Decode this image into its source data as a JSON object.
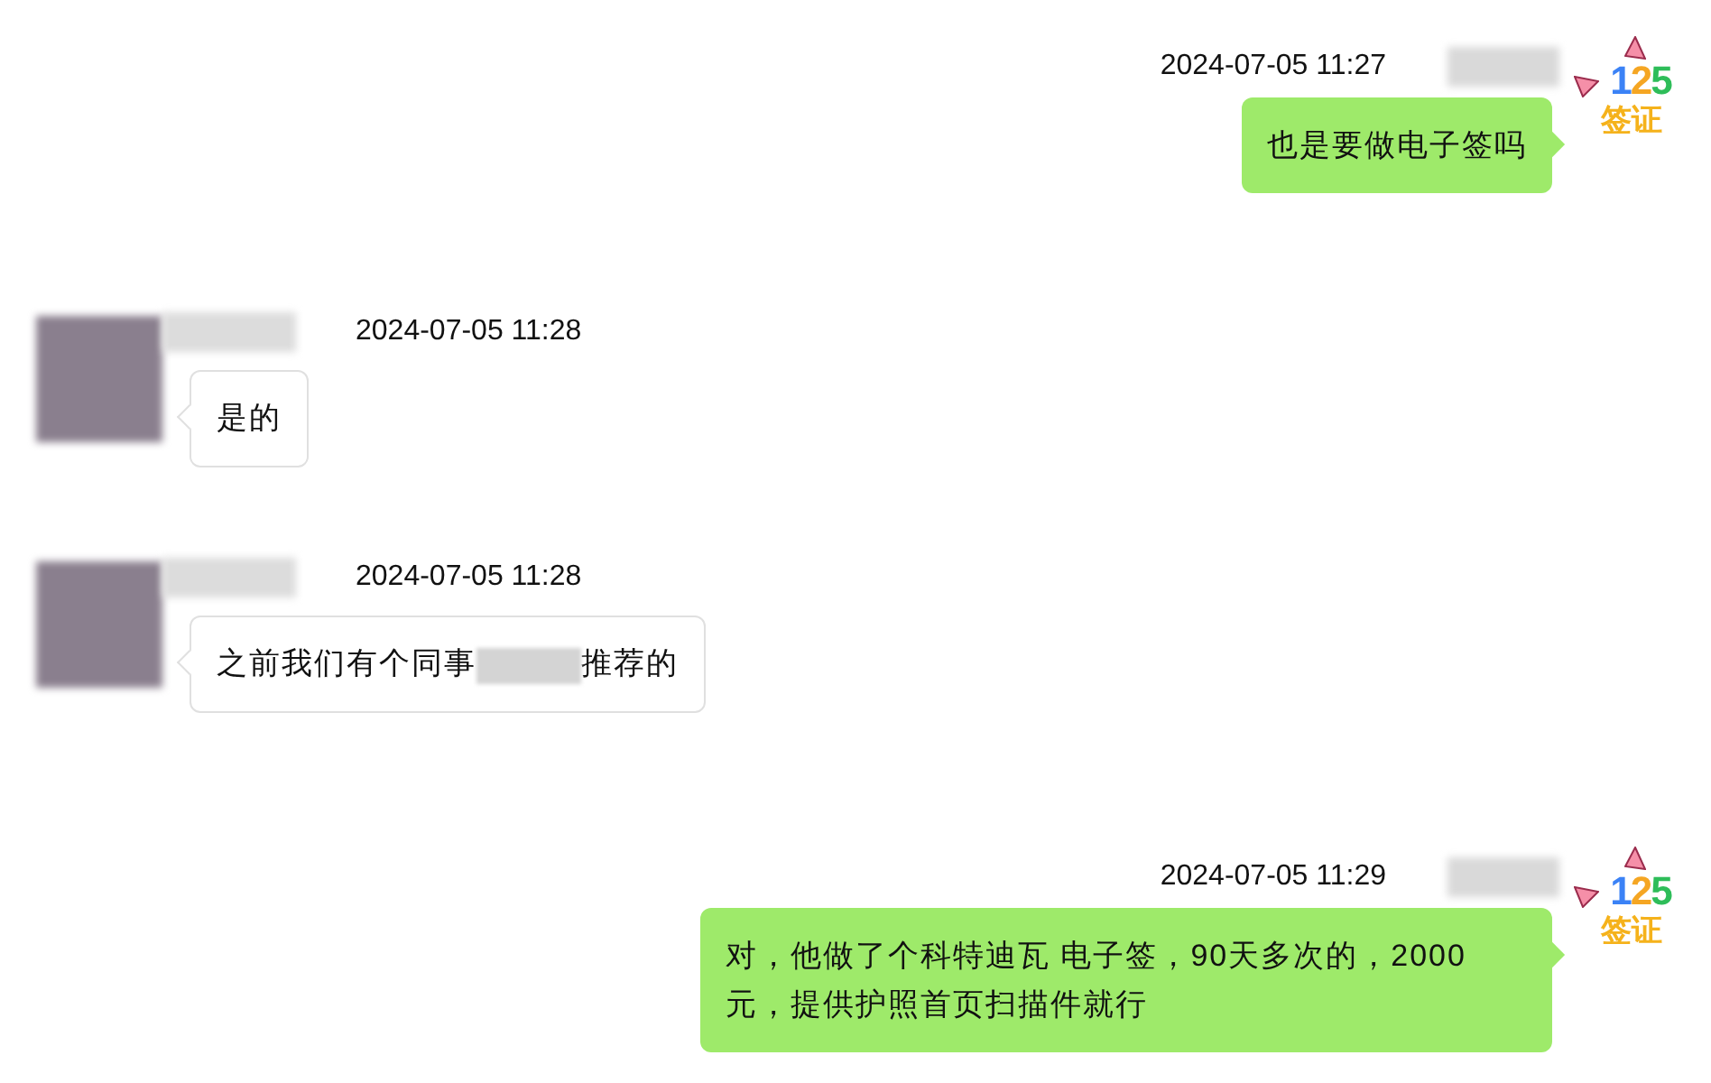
{
  "messages": [
    {
      "kind": "sent",
      "time": "2024-07-05 11:27",
      "segments": [
        {
          "kind": "text",
          "text": "也是要做电子签吗"
        }
      ],
      "avatar": {
        "number": "125",
        "label": "签证"
      }
    },
    {
      "kind": "received",
      "time": "2024-07-05 11:28",
      "segments": [
        {
          "kind": "text",
          "text": "是的"
        }
      ]
    },
    {
      "kind": "received",
      "time": "2024-07-05 11:28",
      "segments": [
        {
          "kind": "text",
          "text": "之前我们有个同事"
        },
        {
          "kind": "redacted"
        },
        {
          "kind": "text",
          "text": "推荐的"
        }
      ]
    },
    {
      "kind": "sent",
      "time": "2024-07-05 11:29",
      "segments": [
        {
          "kind": "text",
          "text": "对，他做了个科特迪瓦 电子签，90天多次的，2000元，提供护照首页扫描件就行"
        }
      ],
      "avatar": {
        "number": "125",
        "label": "签证"
      }
    }
  ]
}
